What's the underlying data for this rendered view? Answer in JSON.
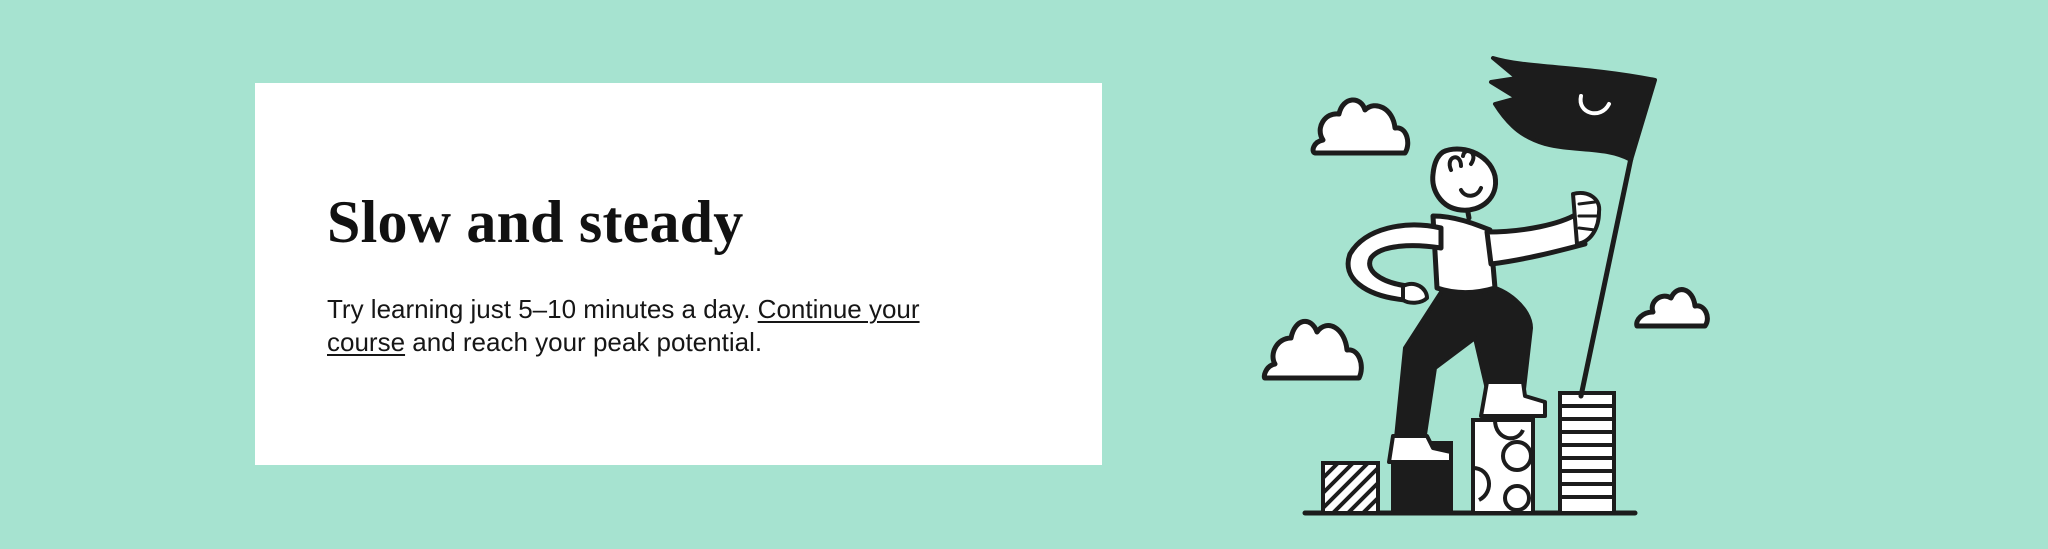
{
  "banner": {
    "title": "Slow and steady",
    "body_before_link": "Try learning just 5–10 minutes a day. ",
    "link_label": "Continue your course",
    "body_after_link": " and reach your peak potential."
  },
  "colors": {
    "background": "#a6e3d0",
    "card": "#ffffff",
    "text": "#111111",
    "ink": "#1c1c1c"
  },
  "illustration": {
    "icon": "person-with-flag-on-blocks-illustration"
  }
}
